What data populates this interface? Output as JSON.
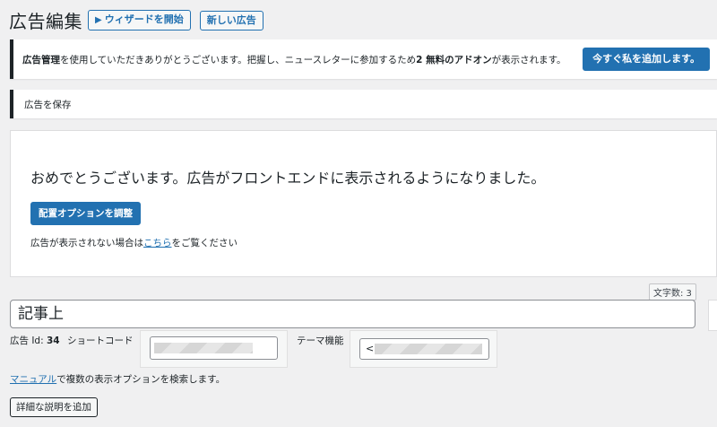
{
  "header": {
    "title": "広告編集",
    "wizard_button": "ウィザードを開始",
    "new_ad_button": "新しい広告"
  },
  "notice": {
    "text_bold1": "広告管理",
    "text_mid": "を使用していただきありがとうございます。把握し、ニュースレターに参加するため",
    "text_bold2": "2 無料のアドオン",
    "text_end": "が表示されます。",
    "button": "今すぐ私を追加します。"
  },
  "saved_notice": "広告を保存",
  "success_box": {
    "message": "おめでとうございます。広告がフロントエンドに表示されるようになりました。",
    "placement_button": "配置オプションを調整",
    "help_prefix": "広告が表示されない場合は",
    "help_link": "こちら",
    "help_suffix": "をご覧ください"
  },
  "word_count": "文字数: 3",
  "ad_title": "記事上",
  "meta": {
    "ad_id_label": "広告 Id:",
    "ad_id_value": "34",
    "shortcode_label": "ショートコード",
    "theme_label": "テーマ機能",
    "theme_prefix": "<"
  },
  "manual": {
    "link": "マニュアル",
    "text": "で複数の表示オプションを検索します。"
  },
  "add_description_button": "詳細な説明を追加",
  "colors": {
    "accent": "#2271b1",
    "background": "#f0f0f1",
    "text": "#1d2327"
  }
}
